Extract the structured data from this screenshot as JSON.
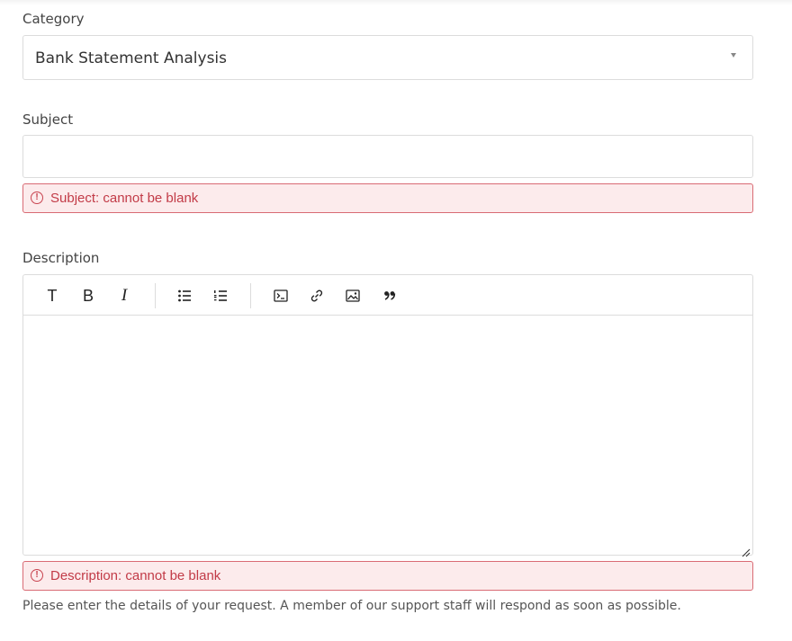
{
  "category": {
    "label": "Category",
    "selected": "Bank Statement Analysis"
  },
  "subject": {
    "label": "Subject",
    "value": "",
    "placeholder": "",
    "error": "Subject: cannot be blank"
  },
  "description": {
    "label": "Description",
    "toolbar": {
      "text_label": "T",
      "bold_label": "B",
      "italic_label": "I",
      "icons": [
        "text-style-icon",
        "bold-icon",
        "italic-icon",
        "bullet-list-icon",
        "numbered-list-icon",
        "code-block-icon",
        "link-icon",
        "image-icon",
        "quote-icon"
      ]
    },
    "error": "Description: cannot be blank",
    "help": "Please enter the details of your request. A member of our support staff will respond as soon as possible."
  },
  "colors": {
    "error_text": "#c23b47",
    "error_border": "#d96b74",
    "error_bg": "#fcebec",
    "border": "#dcdcdc"
  }
}
